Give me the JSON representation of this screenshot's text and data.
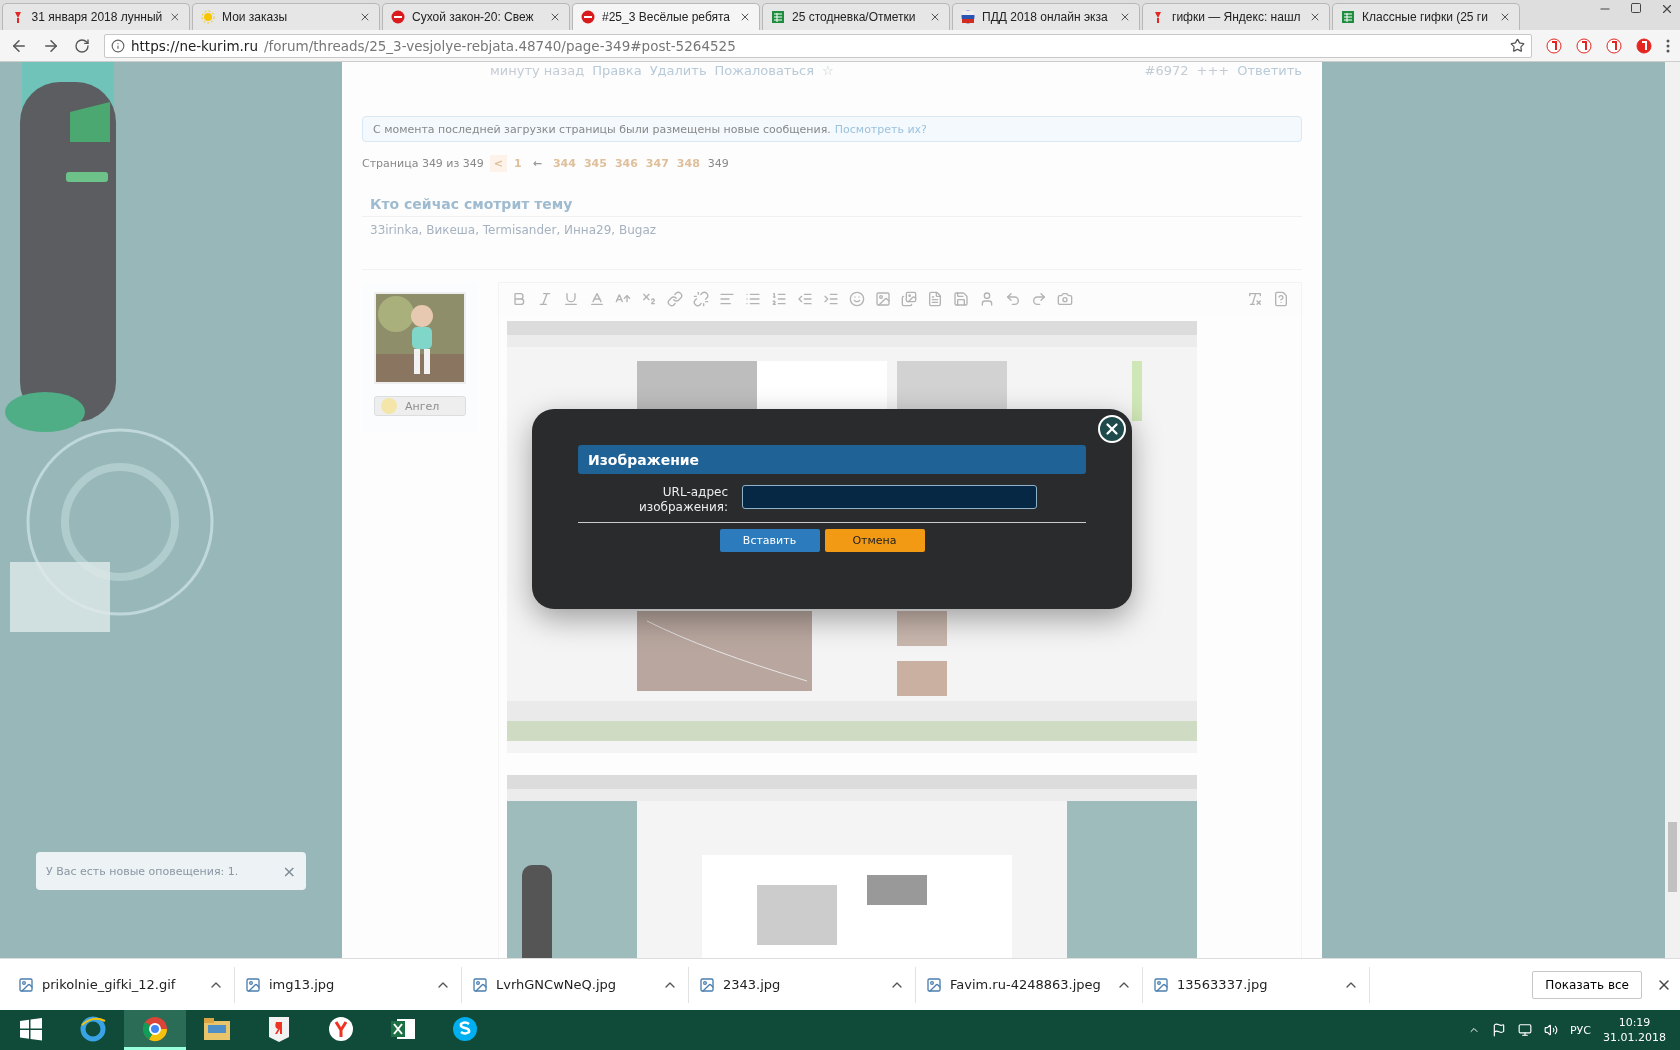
{
  "browser": {
    "tabs": [
      {
        "title": "31 января 2018 лунный",
        "kind": "logo",
        "selected": false
      },
      {
        "title": "Мои заказы",
        "kind": "sun",
        "selected": false
      },
      {
        "title": "Сухой закон-20: Свеж",
        "kind": "stop",
        "selected": false
      },
      {
        "title": "#25_3 Весёлые ребята",
        "kind": "stop",
        "selected": true
      },
      {
        "title": "25 стодневка/Отметки",
        "kind": "sheet",
        "selected": false
      },
      {
        "title": "ПДД 2018 онлайн экза",
        "kind": "flag",
        "selected": false
      },
      {
        "title": "гифки — Яндекс: нашл",
        "kind": "logo",
        "selected": false
      },
      {
        "title": "Классные гифки (25 ги",
        "kind": "sheet",
        "selected": false
      }
    ],
    "url_host": "https://ne-kurim.ru",
    "url_path": "/forum/threads/25_3-vesjolye-rebjata.48740/page-349#post-5264525"
  },
  "post_footer": {
    "time": "минуту назад",
    "actions": [
      "Правка",
      "Удалить",
      "Пожаловаться"
    ],
    "star": "☆",
    "number": "#6972",
    "likes": "+++",
    "reply": "Ответить"
  },
  "notice": {
    "text": "С момента последней загрузки страницы были размещены новые сообщения.",
    "link": "Посмотреть их?"
  },
  "pagination": {
    "label": "Страница 349 из 349",
    "items": [
      {
        "label": "<",
        "kind": "prev",
        "selected": false
      },
      {
        "label": "1",
        "kind": "page",
        "selected": false
      },
      {
        "label": "←",
        "kind": "skip",
        "selected": false
      },
      {
        "label": "344",
        "kind": "page",
        "selected": false
      },
      {
        "label": "345",
        "kind": "page",
        "selected": false
      },
      {
        "label": "346",
        "kind": "page",
        "selected": false
      },
      {
        "label": "347",
        "kind": "page",
        "selected": false
      },
      {
        "label": "348",
        "kind": "page",
        "selected": false
      },
      {
        "label": "349",
        "kind": "page",
        "selected": true
      }
    ]
  },
  "viewers": {
    "title": "Кто сейчас смотрит тему",
    "names": "33irinka, Викеша, Termisander, Инна29, Bugaz"
  },
  "editor": {
    "user_badge": "Ангел"
  },
  "dialog": {
    "title": "Изображение",
    "field_label": "URL-адрес изображения:",
    "buttons": [
      {
        "label": "Вставить",
        "kind": "primary"
      },
      {
        "label": "Отмена",
        "kind": "cancel"
      }
    ]
  },
  "notification": {
    "text": "У Вас есть новые оповещения: 1.",
    "close": "×"
  },
  "downloads": {
    "files": [
      "prikolnie_gifki_12.gif",
      "img13.jpg",
      "LvrhGNCwNeQ.jpg",
      "2343.jpg",
      "Favim.ru-4248863.jpeg",
      "13563337.jpg"
    ],
    "show_all": "Показать все"
  },
  "taskbar": {
    "apps": [
      {
        "kind": "ie",
        "active": false
      },
      {
        "kind": "chrome",
        "active": true
      },
      {
        "kind": "folder",
        "active": false
      },
      {
        "kind": "yabrowser",
        "active": false
      },
      {
        "kind": "yandex",
        "active": false
      },
      {
        "kind": "excel",
        "active": false
      },
      {
        "kind": "skype",
        "active": false
      }
    ],
    "language": "РУС",
    "time": "10:19",
    "date": "31.01.2018"
  }
}
